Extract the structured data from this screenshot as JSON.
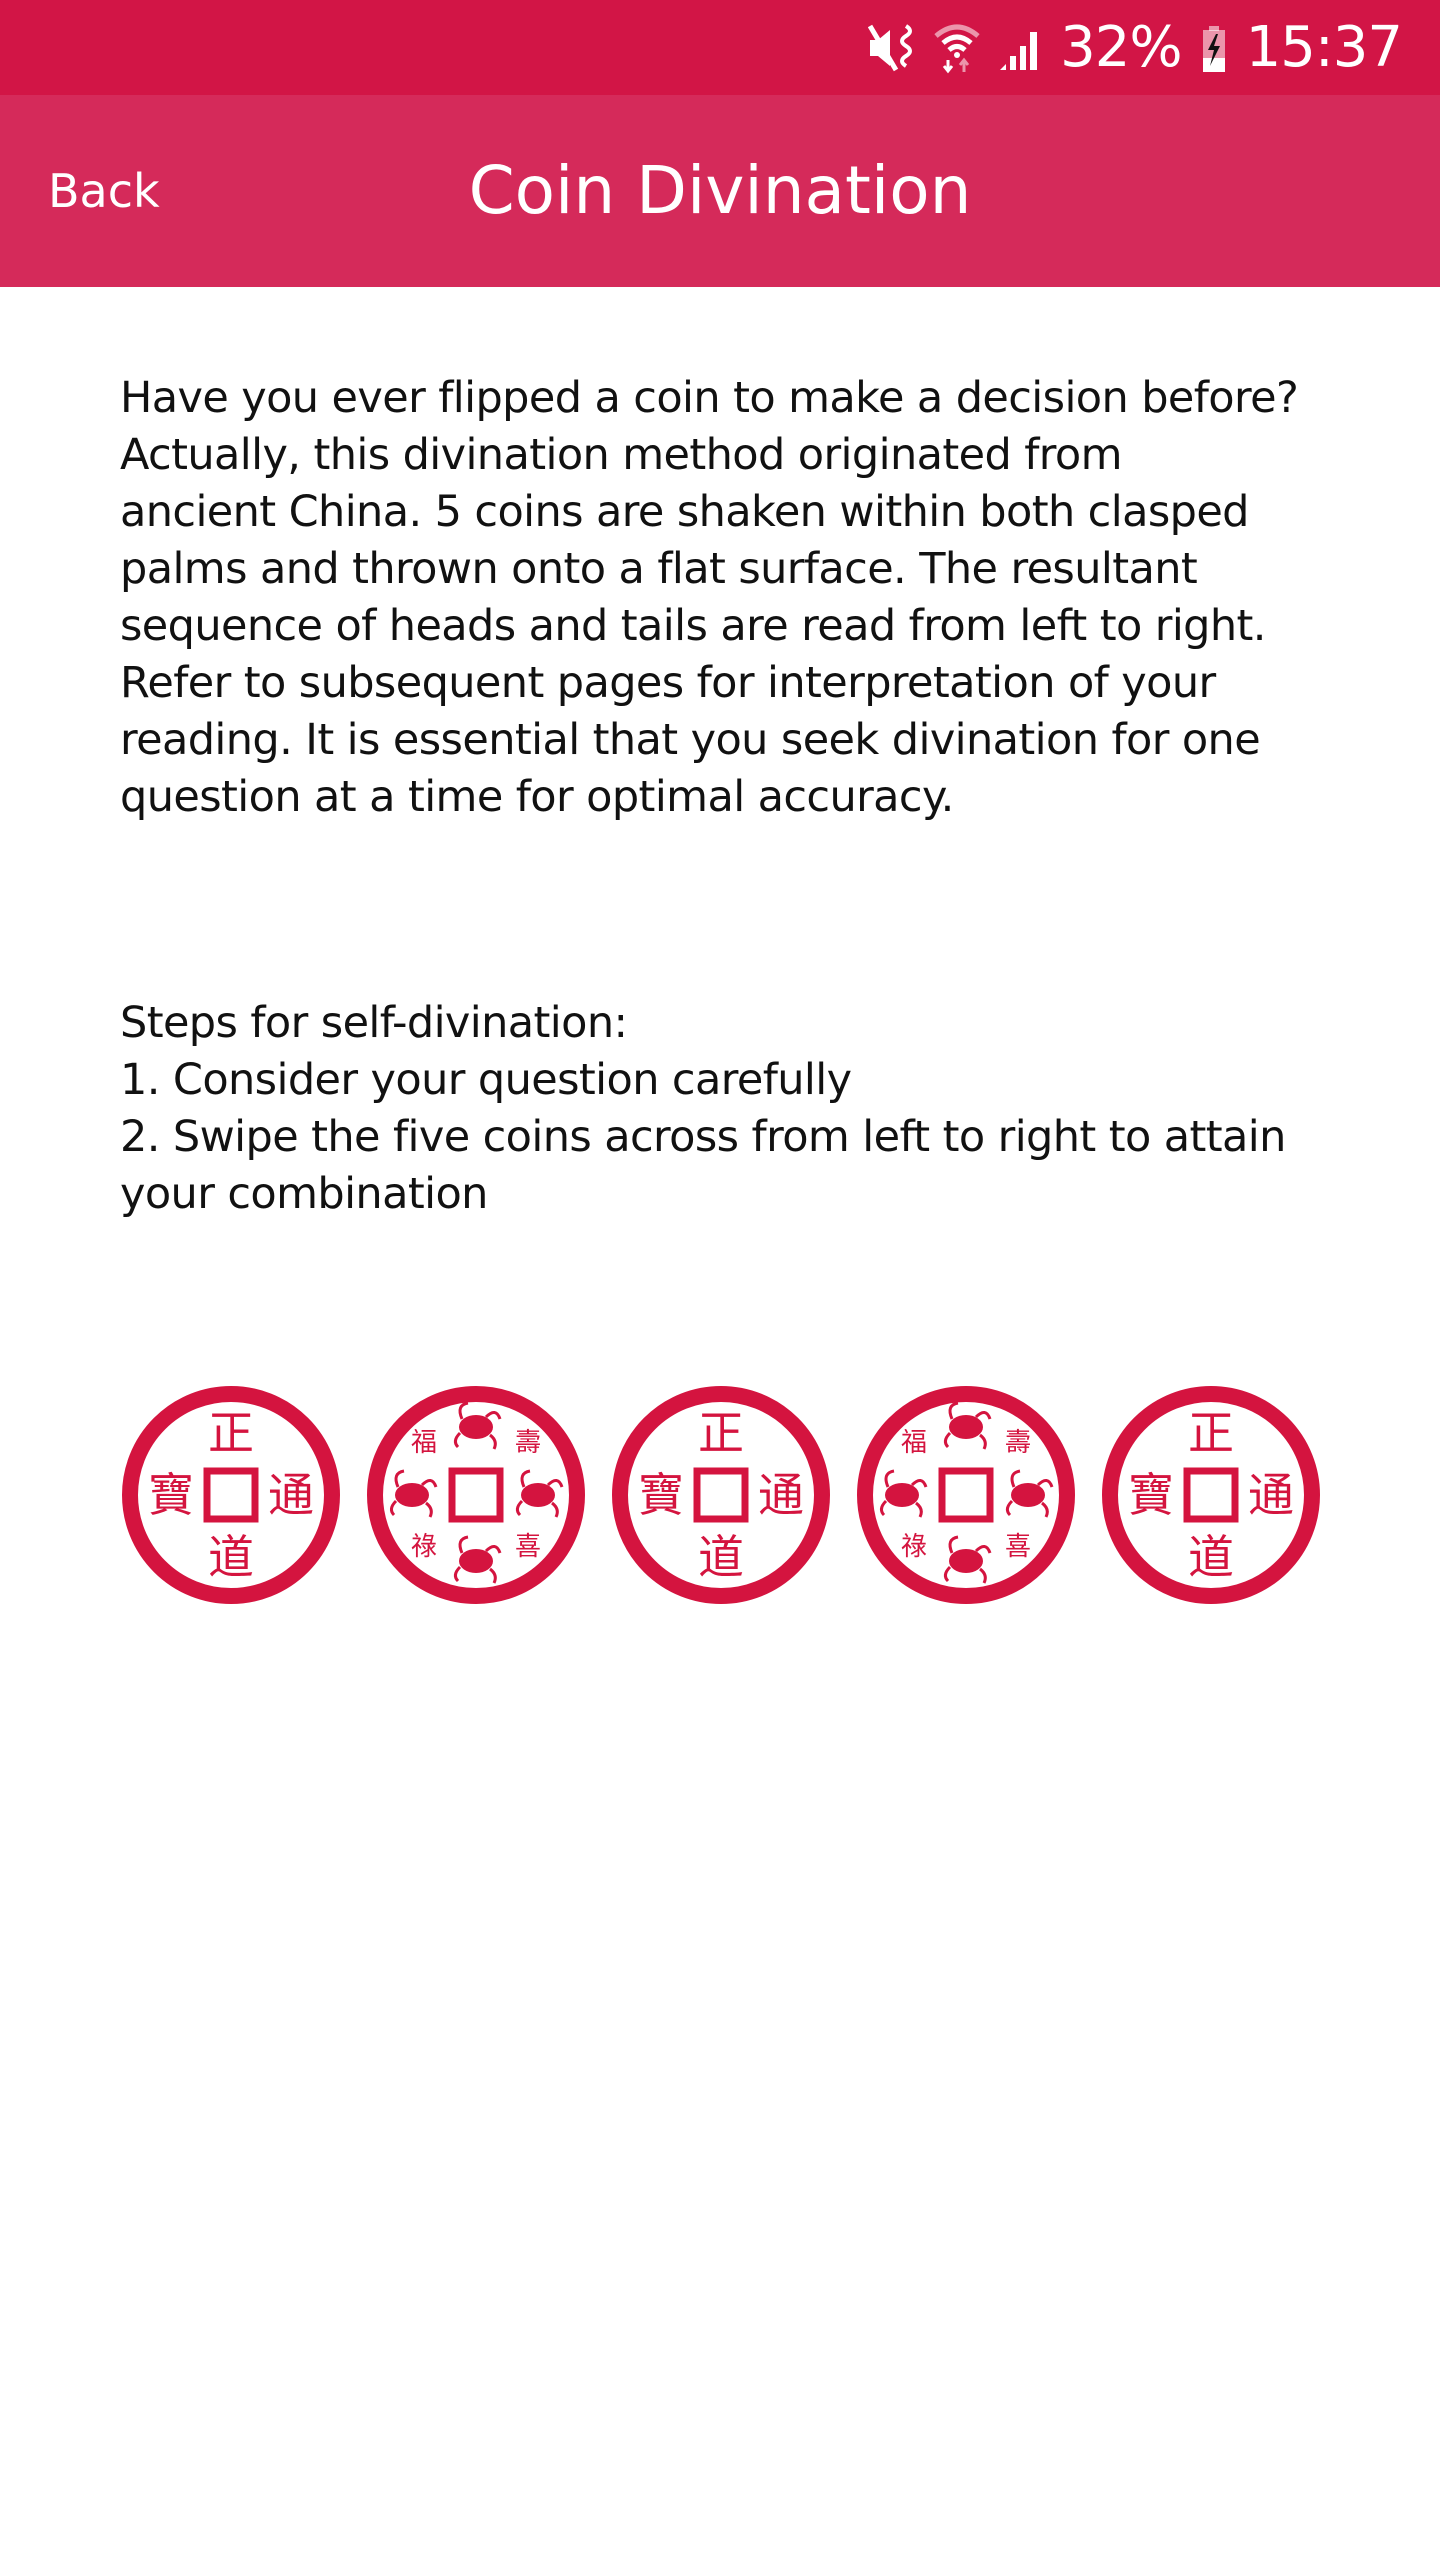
{
  "status_bar": {
    "icons": [
      "mute-vibrate-icon",
      "wifi-data-icon",
      "cellular-signal-icon",
      "battery-charging-icon"
    ],
    "battery_percent": "32%",
    "battery_level": 0.32,
    "time": "15:37"
  },
  "header": {
    "back_label": "Back",
    "title": "Coin Divination"
  },
  "intro": {
    "lines": [
      "Have you ever flipped a coin to make a decision before?",
      "Actually, this divination method originated from",
      "ancient China. 5 coins are shaken within both clasped",
      "palms and thrown onto a flat surface. The resultant",
      "sequence of heads and tails are read from left to right.",
      "Refer to subsequent pages for interpretation of your",
      "reading. It is essential that you seek divination for one",
      "question at a time for optimal accuracy."
    ]
  },
  "steps": {
    "heading": "Steps for self-divination:",
    "items": [
      "1. Consider your question carefully",
      "2. Swipe the five coins across from left to right to attain",
      "your combination"
    ]
  },
  "coins": [
    {
      "face": "characters",
      "top": "正",
      "right": "通",
      "bottom": "道",
      "left": "寶"
    },
    {
      "face": "creatures",
      "marks": [
        "福",
        "壽",
        "祿",
        "喜"
      ]
    },
    {
      "face": "characters",
      "top": "正",
      "right": "通",
      "bottom": "道",
      "left": "寶"
    },
    {
      "face": "creatures",
      "marks": [
        "福",
        "壽",
        "祿",
        "喜"
      ]
    },
    {
      "face": "characters",
      "top": "正",
      "right": "通",
      "bottom": "道",
      "left": "寶"
    }
  ],
  "colors": {
    "status_bar": "#D21546",
    "header": "#D52A5A",
    "coin_red": "#D4143F",
    "text": "#111111"
  }
}
